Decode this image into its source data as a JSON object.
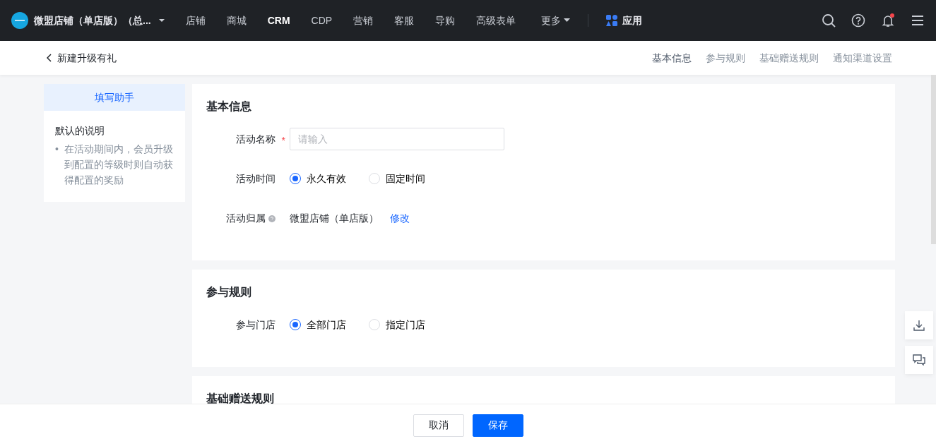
{
  "topnav": {
    "brand": "微盟店铺（单店版）（总...",
    "items": [
      {
        "label": "店铺",
        "selected": false
      },
      {
        "label": "商城",
        "selected": false
      },
      {
        "label": "CRM",
        "selected": true
      },
      {
        "label": "CDP",
        "selected": false
      },
      {
        "label": "营销",
        "selected": false
      },
      {
        "label": "客服",
        "selected": false
      },
      {
        "label": "导购",
        "selected": false
      },
      {
        "label": "高级表单",
        "selected": false
      }
    ],
    "more": "更多",
    "apps": "应用",
    "notification_dot": true
  },
  "subheader": {
    "title": "新建升级有礼",
    "anchors": [
      {
        "label": "基本信息",
        "selected": true
      },
      {
        "label": "参与规则",
        "selected": false
      },
      {
        "label": "基础赠送规则",
        "selected": false
      },
      {
        "label": "通知渠道设置",
        "selected": false
      }
    ]
  },
  "helper": {
    "title": "填写助手",
    "heading": "默认的说明",
    "bullet": "•",
    "bullets": [
      "在活动期间内，会员升级到配置的等级时则自动获得配置的奖励"
    ]
  },
  "sections": [
    {
      "title": "基本信息",
      "fields": [
        {
          "kind": "input",
          "label": "活动名称",
          "required_mark": "*",
          "placeholder": "请输入"
        },
        {
          "kind": "radio",
          "label": "活动时间",
          "options": [
            {
              "label": "永久有效",
              "selected": true
            },
            {
              "label": "固定时间",
              "selected": false
            }
          ]
        },
        {
          "kind": "text",
          "label": "活动归属",
          "help": true,
          "value": "微盟店铺（单店版）",
          "link": "修改"
        }
      ]
    },
    {
      "title": "参与规则",
      "fields": [
        {
          "kind": "radio",
          "label": "参与门店",
          "options": [
            {
              "label": "全部门店",
              "selected": true
            },
            {
              "label": "指定门店",
              "selected": false
            }
          ]
        }
      ]
    },
    {
      "title": "基础赠送规则"
    }
  ],
  "footer": {
    "buttons": [
      {
        "label": "取消",
        "kind": "secondary"
      },
      {
        "label": "保存",
        "kind": "primary"
      }
    ]
  }
}
